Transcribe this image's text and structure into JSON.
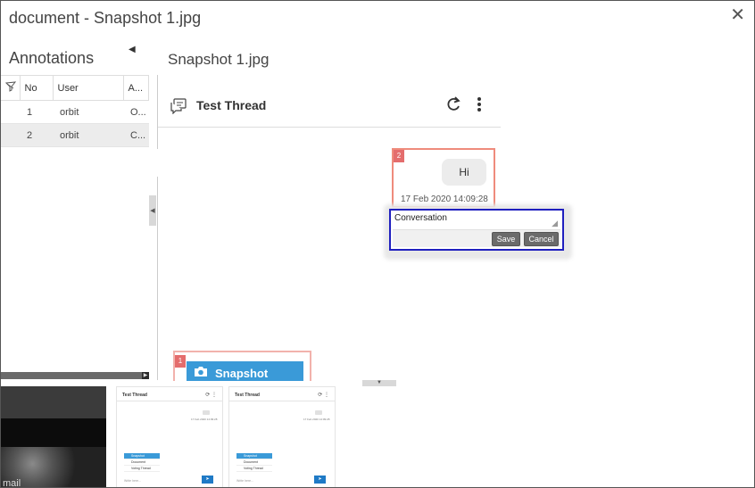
{
  "window": {
    "title": "document - Snapshot 1.jpg",
    "close_glyph": "✕"
  },
  "annotations": {
    "title": "Annotations",
    "columns": {
      "no": "No",
      "user": "User",
      "a": "A..."
    },
    "rows": [
      {
        "no": "1",
        "user": "orbit",
        "a": "O...",
        "selected": false
      },
      {
        "no": "2",
        "user": "orbit",
        "a": "C...",
        "selected": true
      }
    ]
  },
  "main": {
    "title": "Snapshot 1.jpg",
    "thread": {
      "name": "Test Thread"
    },
    "annotation2": {
      "number": "2",
      "message": "Hi",
      "timestamp": "17 Feb 2020 14:09:28"
    },
    "reply": {
      "value": "Conversation",
      "save_label": "Save",
      "cancel_label": "Cancel"
    },
    "annotation1": {
      "number": "1",
      "menu_label": "Snapshot"
    }
  },
  "thumbnails": {
    "dark_caption": "mail",
    "light_header": "Test Thread",
    "light_icons": "⟳ ⋮",
    "light_bubble_date": "17 Feb 2020 14:09:28",
    "light_menu": [
      "Snapshot",
      "Document",
      "Voting Thread"
    ],
    "light_footer": "Write here..."
  },
  "colors": {
    "annotation_border": "#ef8b7c",
    "annotation_badge": "#e46d6d",
    "reply_focus_border": "#1f1fbf",
    "accent": "#3a9ad8"
  },
  "icons": [
    "close-icon",
    "collapse-left-icon",
    "filter-icon",
    "chat-icon",
    "refresh-icon",
    "more-vertical-icon",
    "camera-icon",
    "resize-grip-icon",
    "send-icon"
  ]
}
